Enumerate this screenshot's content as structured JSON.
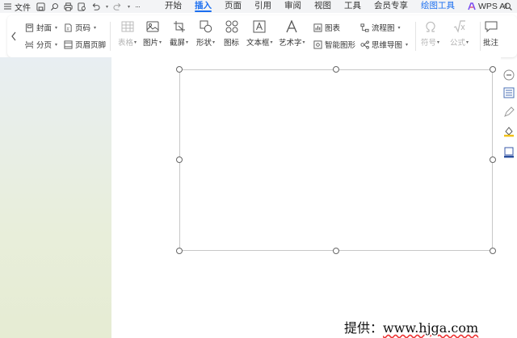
{
  "menubar": {
    "file_label": "文件",
    "tabs": [
      "开始",
      "插入",
      "页面",
      "引用",
      "审阅",
      "视图",
      "工具",
      "会员专享",
      "绘图工具"
    ],
    "active_tab": "插入",
    "ai_label": "WPS AI"
  },
  "ribbon": {
    "cover": "封面",
    "page_break": "分页",
    "page_number": "页码",
    "header_footer": "页眉页脚",
    "table": "表格",
    "picture": "图片",
    "screenshot": "截屏",
    "shape": "形状",
    "icon": "图标",
    "textbox": "文本框",
    "wordart": "艺术字",
    "chart": "图表",
    "smart_graphic": "智能图形",
    "flowchart": "流程图",
    "mindmap": "思维导图",
    "symbol": "符号",
    "formula": "公式",
    "comment": "批注"
  },
  "credit": {
    "prefix": "提供：",
    "url": "www.hjga.com"
  },
  "colors": {
    "accent": "#1a6ef0",
    "menubar_bg": "#f3f4f6",
    "leftpane_top": "#e8eef2",
    "leftpane_bottom": "#e6ecd3"
  }
}
